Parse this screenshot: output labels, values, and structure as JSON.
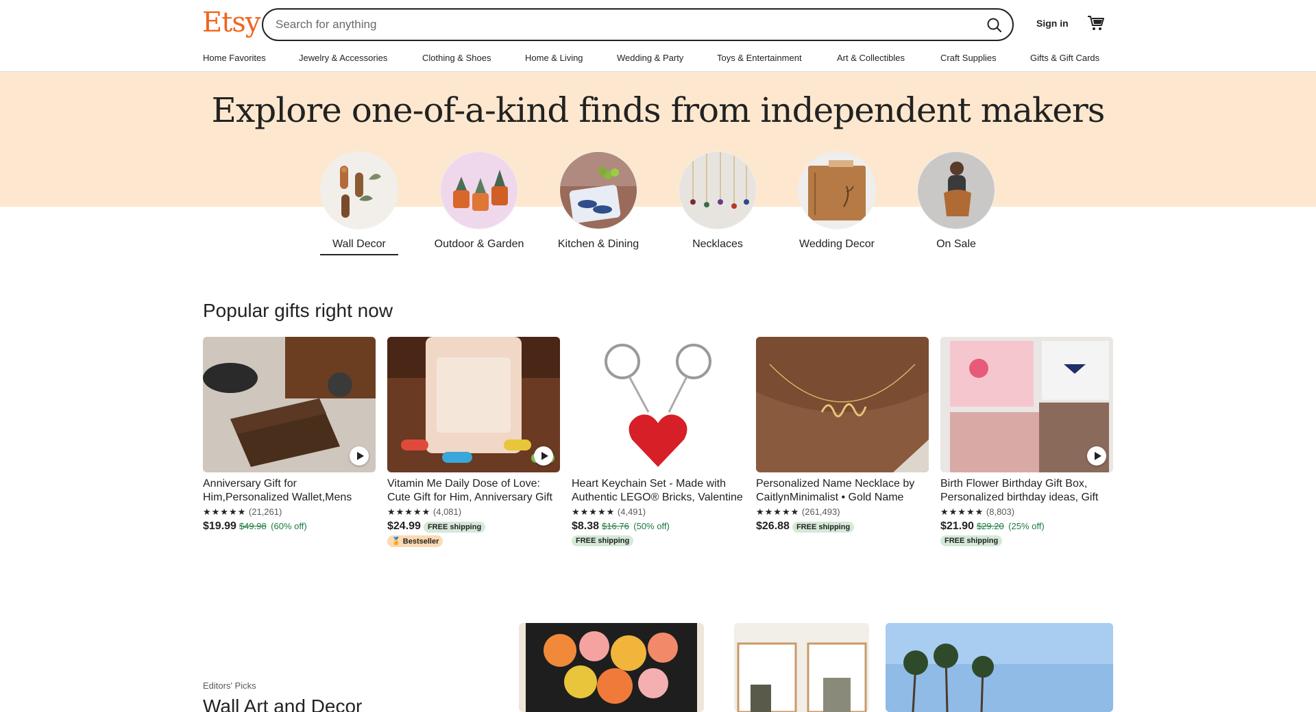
{
  "header": {
    "logo": "Etsy",
    "search_placeholder": "Search for anything",
    "signin_label": "Sign in"
  },
  "nav": [
    "Home Favorites",
    "Jewelry & Accessories",
    "Clothing & Shoes",
    "Home & Living",
    "Wedding & Party",
    "Toys & Entertainment",
    "Art & Collectibles",
    "Craft Supplies",
    "Gifts & Gift Cards"
  ],
  "hero": {
    "title": "Explore one-of-a-kind finds from independent makers",
    "categories": [
      {
        "label": "Wall Decor",
        "active": true
      },
      {
        "label": "Outdoor & Garden"
      },
      {
        "label": "Kitchen & Dining"
      },
      {
        "label": "Necklaces"
      },
      {
        "label": "Wedding Decor"
      },
      {
        "label": "On Sale"
      }
    ]
  },
  "popular": {
    "title": "Popular gifts right now",
    "items": [
      {
        "title": "Anniversary Gift for Him,Personalized Wallet,Mens Wallet",
        "stars": "★★★★★",
        "reviews": "(21,261)",
        "price": "$19.99",
        "orig": "$49.98",
        "discount": "(60% off)"
      },
      {
        "title": "Vitamin Me Daily Dose of Love: Cute Gift for Him, Anniversary Gift",
        "stars": "★★★★★",
        "reviews": "(4,081)",
        "price": "$24.99",
        "shipping": "FREE shipping",
        "badge": "Bestseller"
      },
      {
        "title": "Heart Keychain Set - Made with Authentic LEGO® Bricks, Valentine",
        "stars": "★★★★★",
        "reviews": "(4,491)",
        "price": "$8.38",
        "orig": "$16.76",
        "discount": "(50% off)",
        "shipping": "FREE shipping"
      },
      {
        "title": "Personalized Name Necklace by CaitlynMinimalist • Gold Name Necklace",
        "stars": "★★★★★",
        "reviews": "(261,493)",
        "price": "$26.88",
        "shipping": "FREE shipping"
      },
      {
        "title": "Birth Flower Birthday Gift Box, Personalized birthday ideas, Gift",
        "stars": "★★★★★",
        "reviews": "(8,803)",
        "price": "$21.90",
        "orig": "$29.20",
        "discount": "(25% off)",
        "shipping": "FREE shipping"
      }
    ]
  },
  "editors": {
    "kicker": "Editors' Picks",
    "title": "Wall Art and Decor"
  },
  "colors": {
    "brand": "#f1641e",
    "hero_band": "#fde8cf",
    "sale_green": "#1c7a3e"
  }
}
